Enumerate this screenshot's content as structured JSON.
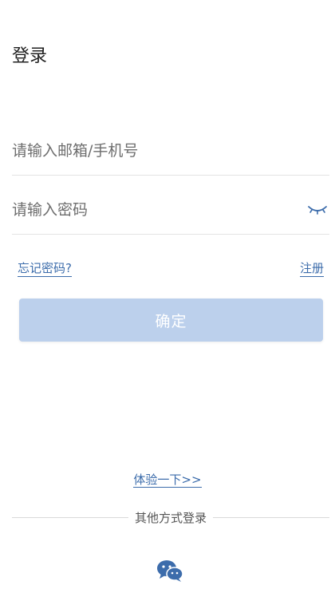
{
  "header": {
    "title": "登录"
  },
  "form": {
    "account_placeholder": "请输入邮箱/手机号",
    "password_placeholder": "请输入密码",
    "password_toggle_icon": "eye-closed-icon"
  },
  "links": {
    "forgot_password": "忘记密码?",
    "register": "注册"
  },
  "confirm_button": {
    "label": "确定",
    "color": "#bcd0ec"
  },
  "trial": {
    "label": "体验一下>>"
  },
  "other_login": {
    "label": "其他方式登录",
    "icons": [
      "wechat-icon"
    ]
  },
  "colors": {
    "link": "#3c6cab"
  }
}
